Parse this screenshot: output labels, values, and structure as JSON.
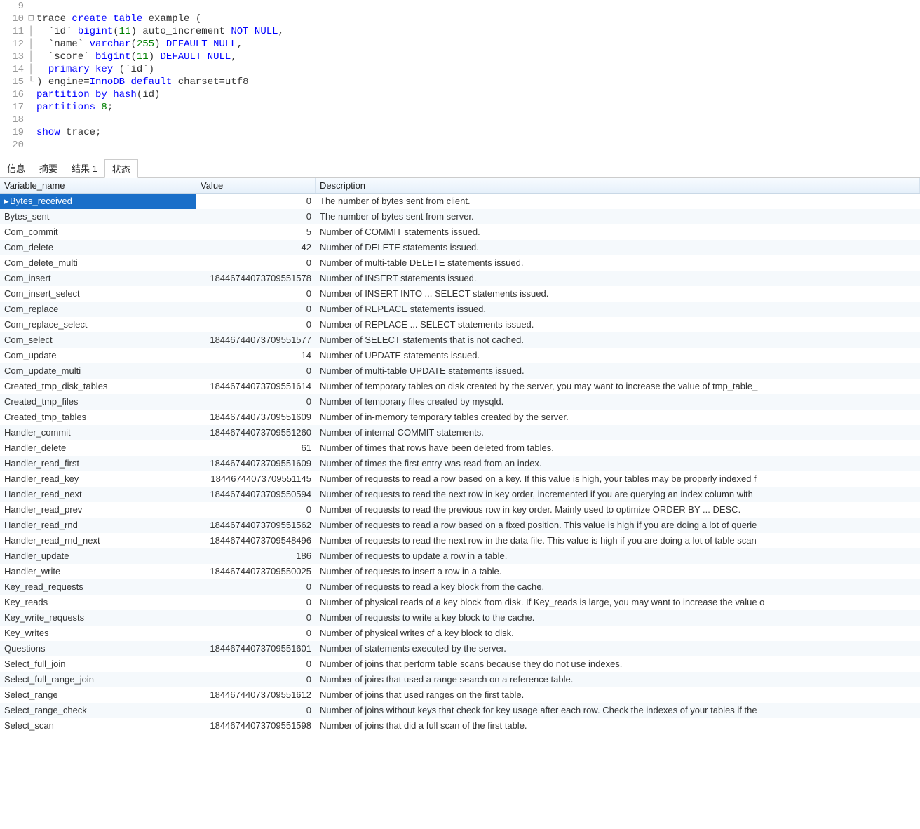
{
  "editor": {
    "lines": [
      {
        "num": 9,
        "fold": "",
        "html": ""
      },
      {
        "num": 10,
        "fold": "⊟",
        "html": "<span class='ident'>trace </span><span class='kw'>create table</span><span class='ident'> example </span><span class='punct'>(</span>"
      },
      {
        "num": 11,
        "fold": "│",
        "html": "  <span class='punct'>`</span><span class='ident'>id</span><span class='punct'>`</span> <span class='type'>bigint</span><span class='punct'>(</span><span class='num'>11</span><span class='punct'>)</span> <span class='ident'>auto_increment </span><span class='kw'>NOT NULL</span><span class='punct'>,</span>"
      },
      {
        "num": 12,
        "fold": "│",
        "html": "  <span class='punct'>`</span><span class='ident'>name</span><span class='punct'>`</span> <span class='type'>varchar</span><span class='punct'>(</span><span class='num'>255</span><span class='punct'>)</span> <span class='kw'>DEFAULT NULL</span><span class='punct'>,</span>"
      },
      {
        "num": 13,
        "fold": "│",
        "html": "  <span class='punct'>`</span><span class='ident'>score</span><span class='punct'>`</span> <span class='type'>bigint</span><span class='punct'>(</span><span class='num'>11</span><span class='punct'>)</span> <span class='kw'>DEFAULT NULL</span><span class='punct'>,</span>"
      },
      {
        "num": 14,
        "fold": "│",
        "html": "  <span class='kw'>primary key</span> <span class='punct'>(`</span><span class='ident'>id</span><span class='punct'>`)</span>"
      },
      {
        "num": 15,
        "fold": "└",
        "html": "<span class='punct'>)</span> <span class='ident'>engine</span><span class='punct'>=</span><span class='type'>InnoDB</span> <span class='kw'>default</span> <span class='ident'>charset</span><span class='punct'>=</span><span class='ident'>utf8</span>"
      },
      {
        "num": 16,
        "fold": "",
        "html": "<span class='kw'>partition by hash</span><span class='punct'>(</span><span class='ident'>id</span><span class='punct'>)</span>"
      },
      {
        "num": 17,
        "fold": "",
        "html": "<span class='kw'>partitions</span> <span class='num'>8</span><span class='punct'>;</span>"
      },
      {
        "num": 18,
        "fold": "",
        "html": ""
      },
      {
        "num": 19,
        "fold": "",
        "html": "<span class='kw'>show</span> <span class='ident'>trace</span><span class='punct'>;</span>"
      },
      {
        "num": 20,
        "fold": "",
        "html": ""
      }
    ]
  },
  "tabs": [
    {
      "label": "信息",
      "active": false
    },
    {
      "label": "摘要",
      "active": false
    },
    {
      "label": "结果 1",
      "active": false
    },
    {
      "label": "状态",
      "active": true
    }
  ],
  "grid": {
    "headers": {
      "var": "Variable_name",
      "val": "Value",
      "desc": "Description"
    },
    "rows": [
      {
        "var": "Bytes_received",
        "val": "0",
        "desc": "The number of bytes sent from client.",
        "selected": true
      },
      {
        "var": "Bytes_sent",
        "val": "0",
        "desc": "The number of bytes sent from server."
      },
      {
        "var": "Com_commit",
        "val": "5",
        "desc": "Number of COMMIT statements issued."
      },
      {
        "var": "Com_delete",
        "val": "42",
        "desc": "Number of DELETE statements issued."
      },
      {
        "var": "Com_delete_multi",
        "val": "0",
        "desc": "Number of multi-table DELETE statements issued."
      },
      {
        "var": "Com_insert",
        "val": "18446744073709551578",
        "desc": "Number of INSERT statements issued."
      },
      {
        "var": "Com_insert_select",
        "val": "0",
        "desc": "Number of INSERT INTO ... SELECT statements issued."
      },
      {
        "var": "Com_replace",
        "val": "0",
        "desc": "Number of REPLACE statements issued."
      },
      {
        "var": "Com_replace_select",
        "val": "0",
        "desc": "Number of REPLACE ... SELECT statements issued."
      },
      {
        "var": "Com_select",
        "val": "18446744073709551577",
        "desc": "Number of SELECT statements that is not cached."
      },
      {
        "var": "Com_update",
        "val": "14",
        "desc": "Number of UPDATE statements issued."
      },
      {
        "var": "Com_update_multi",
        "val": "0",
        "desc": "Number of multi-table UPDATE statements issued."
      },
      {
        "var": "Created_tmp_disk_tables",
        "val": "18446744073709551614",
        "desc": "Number of temporary tables on disk created by the server, you may want to increase the value of tmp_table_"
      },
      {
        "var": "Created_tmp_files",
        "val": "0",
        "desc": "Number of temporary files created by mysqld."
      },
      {
        "var": "Created_tmp_tables",
        "val": "18446744073709551609",
        "desc": "Number of in-memory temporary tables created by the server."
      },
      {
        "var": "Handler_commit",
        "val": "18446744073709551260",
        "desc": "Number of internal COMMIT statements."
      },
      {
        "var": "Handler_delete",
        "val": "61",
        "desc": "Number of times that rows have been deleted from tables."
      },
      {
        "var": "Handler_read_first",
        "val": "18446744073709551609",
        "desc": "Number of times the first entry was read from an index."
      },
      {
        "var": "Handler_read_key",
        "val": "18446744073709551145",
        "desc": "Number of requests to read a row based on a key. If this value is high, your tables may be properly indexed f"
      },
      {
        "var": "Handler_read_next",
        "val": "18446744073709550594",
        "desc": "Number of requests to read the next row in key order, incremented if you are querying an index column with"
      },
      {
        "var": "Handler_read_prev",
        "val": "0",
        "desc": "Number of requests to read the previous row in key order. Mainly used to optimize ORDER BY ... DESC."
      },
      {
        "var": "Handler_read_rnd",
        "val": "18446744073709551562",
        "desc": "Number of requests to read a row based on a fixed position. This value is high if you are doing a lot of querie"
      },
      {
        "var": "Handler_read_rnd_next",
        "val": "18446744073709548496",
        "desc": "Number of requests to read the next row in the data file. This value is high if you are doing a lot of table scan"
      },
      {
        "var": "Handler_update",
        "val": "186",
        "desc": "Number of requests to update a row in a table."
      },
      {
        "var": "Handler_write",
        "val": "18446744073709550025",
        "desc": "Number of requests to insert a row in a table."
      },
      {
        "var": "Key_read_requests",
        "val": "0",
        "desc": "Number of requests to read a key block from the cache."
      },
      {
        "var": "Key_reads",
        "val": "0",
        "desc": "Number of physical reads of a key block from disk. If Key_reads is large, you may want to increase the value o"
      },
      {
        "var": "Key_write_requests",
        "val": "0",
        "desc": "Number of requests to write a key block to the cache."
      },
      {
        "var": "Key_writes",
        "val": "0",
        "desc": "Number of physical writes of a key block to disk."
      },
      {
        "var": "Questions",
        "val": "18446744073709551601",
        "desc": "Number of statements executed by the server."
      },
      {
        "var": "Select_full_join",
        "val": "0",
        "desc": "Number of joins that perform table scans because they do not use indexes."
      },
      {
        "var": "Select_full_range_join",
        "val": "0",
        "desc": "Number of joins that used a range search on a reference table."
      },
      {
        "var": "Select_range",
        "val": "18446744073709551612",
        "desc": "Number of joins that used ranges on the first table."
      },
      {
        "var": "Select_range_check",
        "val": "0",
        "desc": "Number of joins without keys that check for key usage after each row. Check the indexes of your tables if the"
      },
      {
        "var": "Select_scan",
        "val": "18446744073709551598",
        "desc": "Number of joins that did a full scan of the first table."
      }
    ]
  }
}
